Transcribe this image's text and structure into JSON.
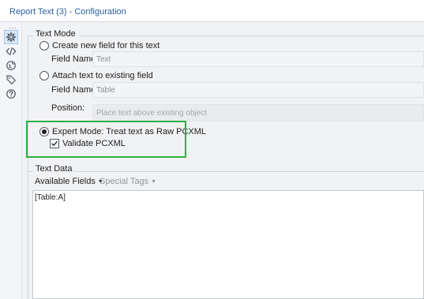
{
  "window": {
    "title": "Report Text (3) - Configuration"
  },
  "rail": {
    "dots": "...",
    "items": [
      {
        "icon": "gear-icon",
        "active": true
      },
      {
        "icon": "code-icon",
        "active": false
      },
      {
        "icon": "globe-icon",
        "active": false
      },
      {
        "icon": "tag-icon",
        "active": false
      },
      {
        "icon": "help-icon",
        "active": false
      }
    ]
  },
  "text_mode": {
    "legend": "Text Mode",
    "create_new": {
      "label": "Create new field for this text",
      "selected": false,
      "field_name_label": "Field Name:",
      "field_name_value": "Text"
    },
    "attach_existing": {
      "label": "Attach text to existing field",
      "selected": false,
      "field_name_label": "Field Name:",
      "field_name_value": "Table",
      "position_label": "Position:",
      "position_value": "Place text above existing object"
    },
    "expert_mode": {
      "label": "Expert Mode: Treat text as Raw PCXML",
      "selected": true,
      "validate_label": "Validate PCXML",
      "validate_checked": true
    }
  },
  "text_data": {
    "legend": "Text Data",
    "available_fields": "Available Fields",
    "special_tags": "Special Tags",
    "editor_content": "[Table:A]"
  },
  "colors": {
    "highlight": "#2db042",
    "title": "#2a5f9e"
  }
}
